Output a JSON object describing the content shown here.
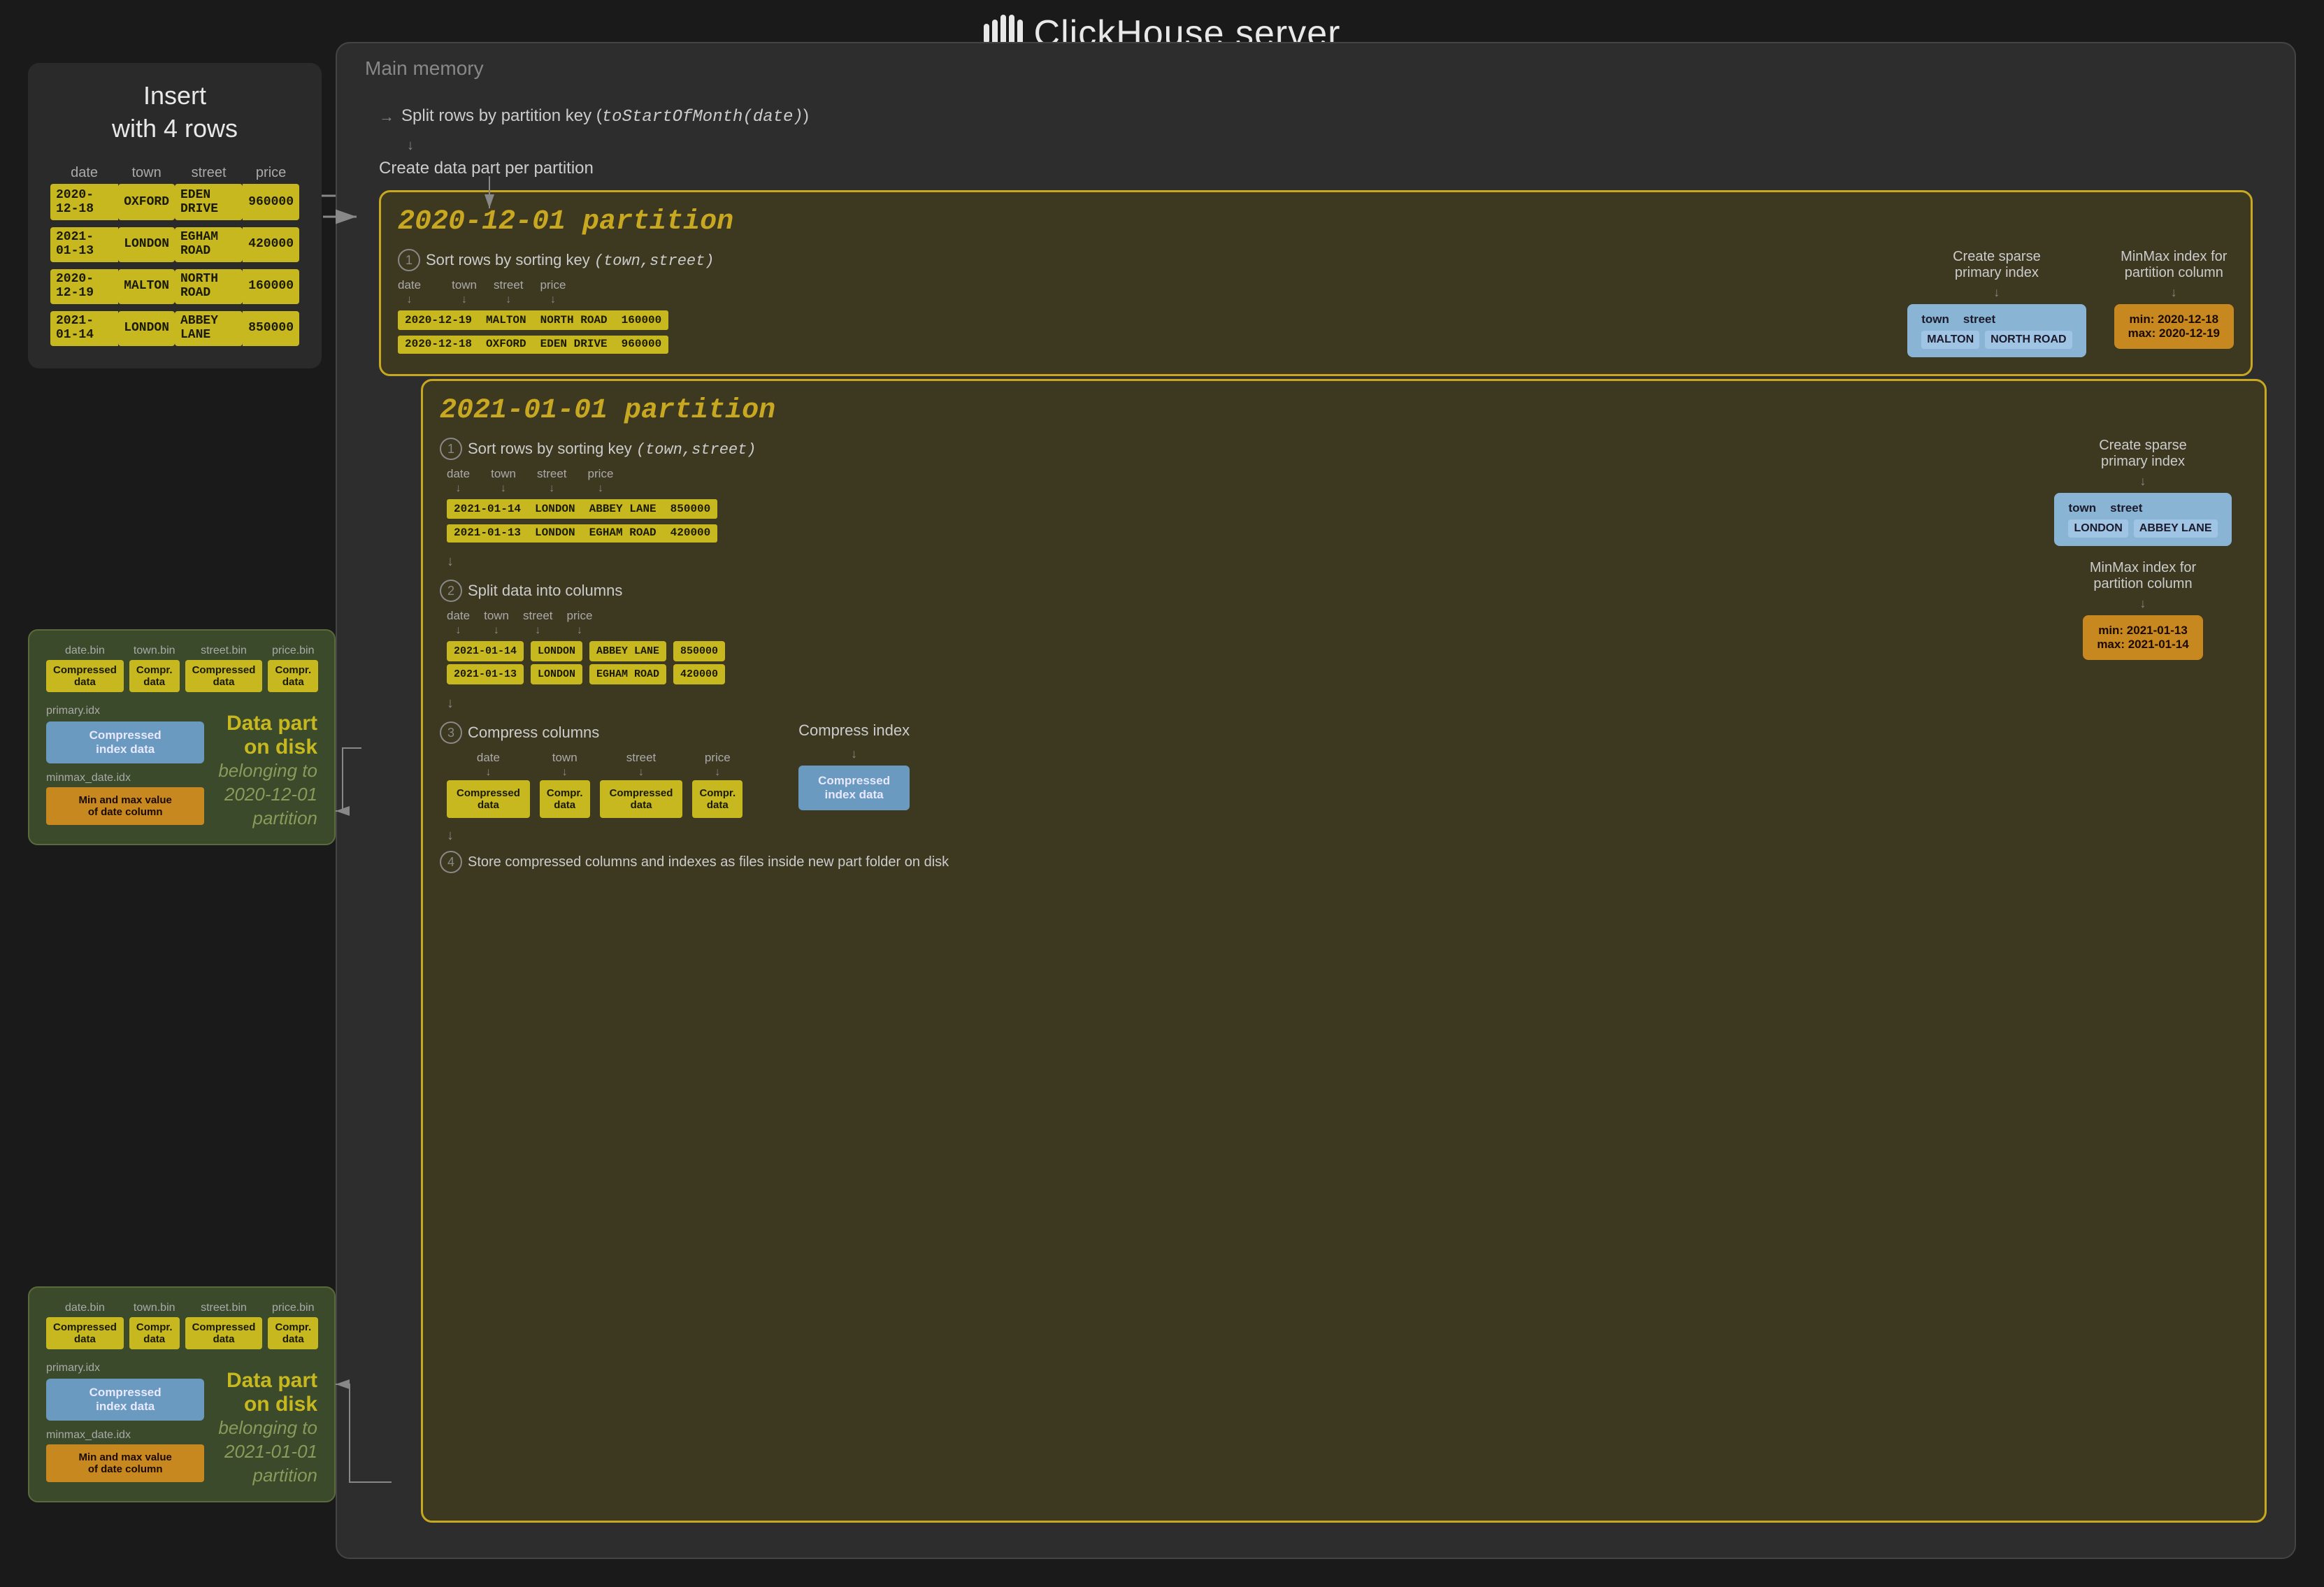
{
  "header": {
    "title": "ClickHouse server",
    "icon_bars": [
      20,
      30,
      40,
      50,
      35
    ]
  },
  "insert_box": {
    "title": "Insert\nwith 4 rows",
    "columns": [
      "date",
      "town",
      "street",
      "price"
    ],
    "rows": [
      {
        "date": "2020-12-18",
        "town": "OXFORD",
        "street": "EDEN DRIVE",
        "price": "960000"
      },
      {
        "date": "2021-01-13",
        "town": "LONDON",
        "street": "EGHAM ROAD",
        "price": "420000"
      },
      {
        "date": "2020-12-19",
        "town": "MALTON",
        "street": "NORTH ROAD",
        "price": "160000"
      },
      {
        "date": "2021-01-14",
        "town": "LONDON",
        "street": "ABBEY LANE",
        "price": "850000"
      }
    ]
  },
  "server": {
    "memory_label": "Main memory",
    "split_label": "Split rows by partition key (toStartOfMonth(date))",
    "create_part_label": "Create data part per partition"
  },
  "partition_2020": {
    "title": "2020-12-01 partition",
    "step1_label": "Sort rows by sorting key",
    "step1_key": "(town,street)",
    "create_sparse_label": "Create sparse\nprimary index",
    "minmax_label": "MinMax index for\npartition column",
    "rows": [
      {
        "date": "2020-12-19",
        "town": "MALTON",
        "street": "NORTH ROAD",
        "price": "160000"
      },
      {
        "date": "2020-12-18",
        "town": "OXFORD",
        "street": "EDEN DRIVE",
        "price": "960000"
      }
    ],
    "primary_index": {
      "col1": "town",
      "col2": "street",
      "val1": "MALTON",
      "val2": "NORTH ROAD"
    },
    "minmax": {
      "min": "2020-12-18",
      "max": "2020-12-19"
    }
  },
  "partition_2021": {
    "title": "2021-01-01 partition",
    "step1_label": "Sort rows by sorting key",
    "step1_key": "(town,street)",
    "create_sparse_label": "Create sparse\nprimary index",
    "minmax_label": "MinMax index for\npartition column",
    "rows": [
      {
        "date": "2021-01-14",
        "town": "LONDON",
        "street": "ABBEY LANE",
        "price": "850000"
      },
      {
        "date": "2021-01-13",
        "town": "LONDON",
        "street": "EGHAM ROAD",
        "price": "420000"
      }
    ],
    "primary_index": {
      "col1": "town",
      "col2": "street",
      "val1": "LONDON",
      "val2": "ABBEY LANE"
    },
    "minmax": {
      "min": "2021-01-13",
      "max": "2021-01-14"
    },
    "step2_label": "Split data into columns",
    "step2_cols": [
      "date",
      "town",
      "street",
      "price"
    ],
    "step2_rows": [
      {
        "date": "2021-01-14",
        "town": "LONDON",
        "street": "ABBEY LANE",
        "price": "850000"
      },
      {
        "date": "2021-01-13",
        "town": "LONDON",
        "street": "EGHAM ROAD",
        "price": "420000"
      }
    ],
    "step3_label": "Compress columns",
    "compress_index_label": "Compress index",
    "compressed_cols": [
      {
        "header": "date",
        "label": "Compressed\ndata"
      },
      {
        "header": "town",
        "label": "Compr.\ndata"
      },
      {
        "header": "street",
        "label": "Compressed\ndata"
      },
      {
        "header": "price",
        "label": "Compr.\ndata"
      }
    ],
    "compressed_index_label": "Compressed\nindex data",
    "step4_label": "Store compressed columns and indexes as files inside new part folder on disk"
  },
  "disk_panel_2020": {
    "files": [
      {
        "label": "date.bin",
        "value": "Compressed\ndata"
      },
      {
        "label": "town.bin",
        "value": "Compr.\ndata"
      },
      {
        "label": "street.bin",
        "value": "Compressed\ndata"
      },
      {
        "label": "price.bin",
        "value": "Compr.\ndata"
      }
    ],
    "primary_label": "primary.idx",
    "primary_value": "Compressed\nindex data",
    "minmax_label": "minmax_date.idx",
    "minmax_value": "Min and max value\nof date column",
    "title": "Data part\non disk",
    "subtitle": "belonging to\n2020-12-01\npartition"
  },
  "disk_panel_2021": {
    "files": [
      {
        "label": "date.bin",
        "value": "Compressed\ndata"
      },
      {
        "label": "town.bin",
        "value": "Compr.\ndata"
      },
      {
        "label": "street.bin",
        "value": "Compressed\ndata"
      },
      {
        "label": "price.bin",
        "value": "Compr.\ndata"
      }
    ],
    "primary_label": "primary.idx",
    "primary_value": "Compressed\nindex data",
    "minmax_label": "minmax_date.idx",
    "minmax_value": "Min and max value\nof date column",
    "title": "Data part\non disk",
    "subtitle": "belonging to\n2021-01-01\npartition"
  }
}
